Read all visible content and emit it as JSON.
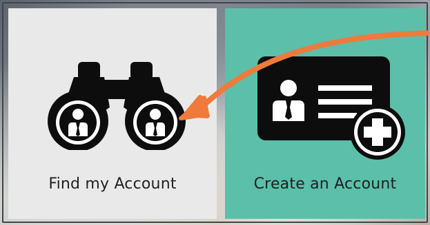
{
  "tiles": {
    "find": {
      "label": "Find my Account",
      "icon": "binoculars-icon",
      "bg": "#e9e9e9"
    },
    "create": {
      "label": "Create an Account",
      "icon": "id-card-add-icon",
      "bg": "#5bbfa9"
    }
  },
  "colors": {
    "icon": "#0d0d0d",
    "arrow": "#ef7a3c",
    "label": "#1f1f1f",
    "teal": "#5bbfa9"
  }
}
